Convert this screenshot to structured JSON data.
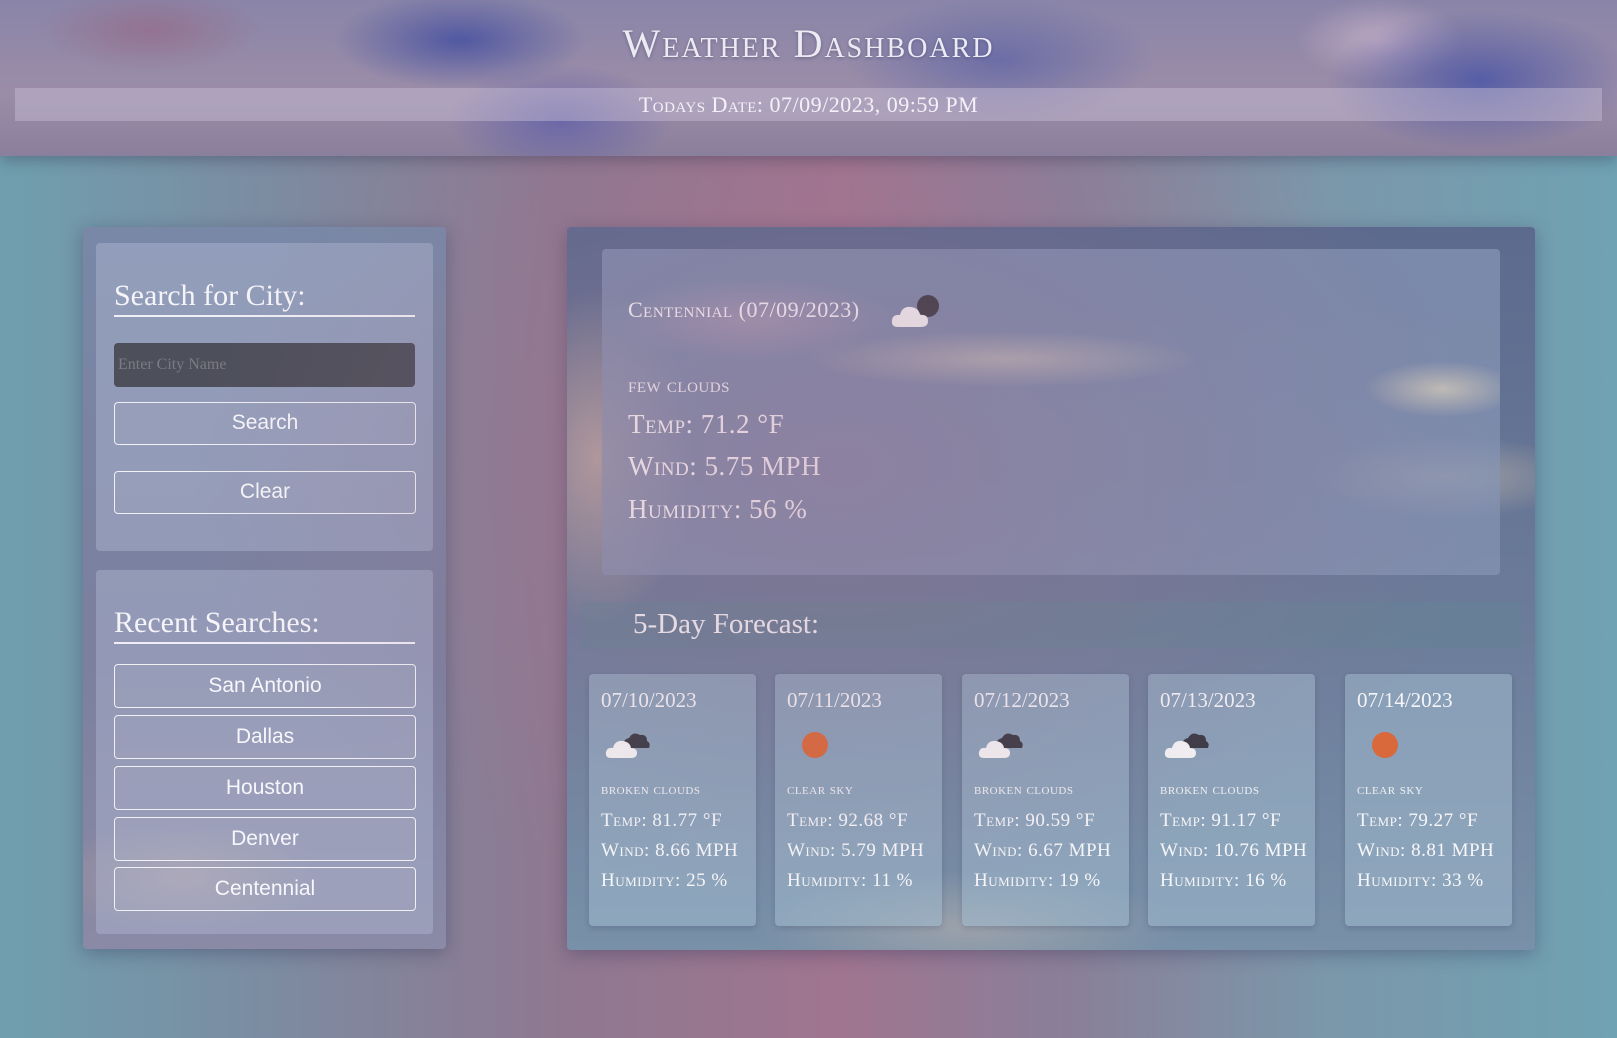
{
  "header": {
    "title": "Weather Dashboard",
    "date_text": "Todays Date: 07/09/2023, 09:59 PM"
  },
  "search": {
    "heading": "Search for City:",
    "placeholder": "Enter City Name",
    "search_label": "Search",
    "clear_label": "Clear"
  },
  "recent": {
    "heading": "Recent Searches:",
    "items": [
      "San Antonio",
      "Dallas",
      "Houston",
      "Denver",
      "Centennial"
    ]
  },
  "current": {
    "title": "Centennial (07/09/2023)",
    "icon": "few-clouds-night-icon",
    "description": "few clouds",
    "temp": "Temp: 71.2 °F",
    "wind": "Wind: 5.75 MPH",
    "humidity": "Humidity: 56 %"
  },
  "forecast": {
    "heading": "5-Day Forecast:",
    "days": [
      {
        "date": "07/10/2023",
        "icon": "broken-clouds-icon",
        "description": "broken clouds",
        "temp": "Temp: 81.77 °F",
        "wind": "Wind: 8.66 MPH",
        "humidity": "Humidity: 25 %"
      },
      {
        "date": "07/11/2023",
        "icon": "clear-sky-sun-icon",
        "description": "clear sky",
        "temp": "Temp: 92.68 °F",
        "wind": "Wind: 5.79 MPH",
        "humidity": "Humidity: 11 %"
      },
      {
        "date": "07/12/2023",
        "icon": "broken-clouds-icon",
        "description": "broken clouds",
        "temp": "Temp: 90.59 °F",
        "wind": "Wind: 6.67 MPH",
        "humidity": "Humidity: 19 %"
      },
      {
        "date": "07/13/2023",
        "icon": "broken-clouds-icon",
        "description": "broken clouds",
        "temp": "Temp: 91.17 °F",
        "wind": "Wind: 10.76 MPH",
        "humidity": "Humidity: 16 %"
      },
      {
        "date": "07/14/2023",
        "icon": "clear-sky-sun-icon",
        "description": "clear sky",
        "temp": "Temp: 79.27 °F",
        "wind": "Wind: 8.81 MPH",
        "humidity": "Humidity: 33 %"
      }
    ]
  },
  "colors": {
    "sun": "#d9693a",
    "cloud_front": "#f4f4f6",
    "cloud_back": "#3a3a44"
  }
}
